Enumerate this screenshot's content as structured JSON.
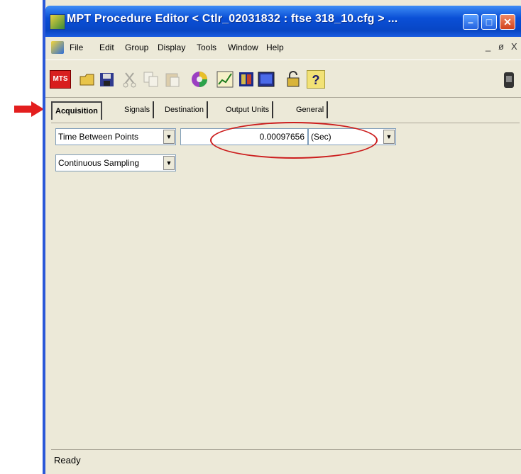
{
  "window": {
    "title": "MPT Procedure Editor  < Ctlr_02031832 : ftse 318_10.cfg >  ...",
    "app_icon": "mpt-app-icon",
    "controls": [
      "minimize-icon",
      "maximize-icon",
      "close-icon"
    ],
    "accent_color": "#0a4fd6"
  },
  "menubar": {
    "items": [
      "File",
      "Edit",
      "Group",
      "Display",
      "Tools",
      "Window",
      "Help"
    ],
    "mdi_controls": [
      "_",
      "ø",
      "X"
    ]
  },
  "toolbar": {
    "buttons": [
      "mts-logo",
      "open-folder-icon",
      "save-icon",
      "cut-icon",
      "copy-icon",
      "paste-icon",
      "color-wheel-icon",
      "chart-icon",
      "book-icon",
      "monitor-icon",
      "lock-icon",
      "help-icon",
      "station-icon"
    ],
    "mts_label": "MTS",
    "help_label": "?"
  },
  "tabs": {
    "items": [
      "Acquisition",
      "Signals",
      "Destination",
      "Output Units",
      "General"
    ],
    "active": "Acquisition"
  },
  "acquisition": {
    "mode_select": "Time Between Points",
    "value": "0.00097656",
    "unit_select": "(Sec)",
    "sampling_select": "Continuous Sampling"
  },
  "status": {
    "text": "Ready"
  },
  "annotations": {
    "arrow_color": "#e31e1e",
    "ellipse_color": "#cc1e1e"
  }
}
